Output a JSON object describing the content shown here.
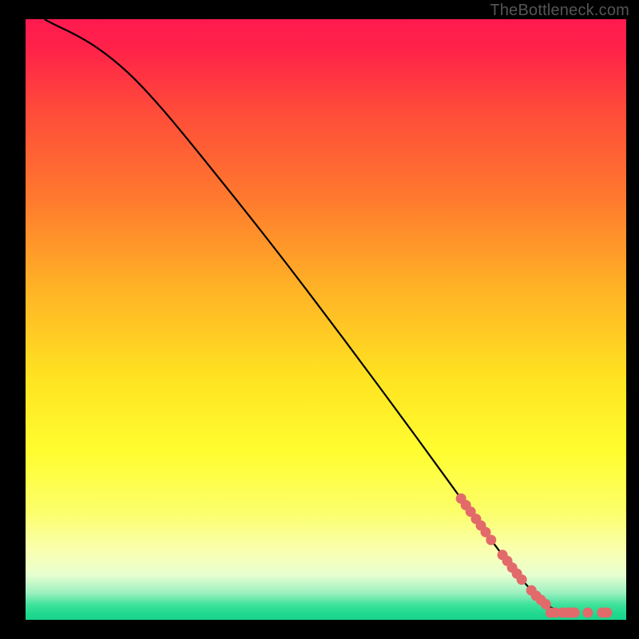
{
  "watermark": "TheBottleneck.com",
  "chart_data": {
    "type": "line",
    "title": "",
    "xlabel": "",
    "ylabel": "",
    "xlim": [
      0,
      100
    ],
    "ylim": [
      0,
      100
    ],
    "background_gradient_stops": [
      {
        "offset": 0.0,
        "color": "#ff1a4f"
      },
      {
        "offset": 0.05,
        "color": "#ff2249"
      },
      {
        "offset": 0.15,
        "color": "#ff4a3a"
      },
      {
        "offset": 0.3,
        "color": "#ff7a2e"
      },
      {
        "offset": 0.45,
        "color": "#ffb326"
      },
      {
        "offset": 0.6,
        "color": "#ffe421"
      },
      {
        "offset": 0.72,
        "color": "#fffd30"
      },
      {
        "offset": 0.82,
        "color": "#fcff6a"
      },
      {
        "offset": 0.885,
        "color": "#f9ffb0"
      },
      {
        "offset": 0.925,
        "color": "#e8ffd0"
      },
      {
        "offset": 0.955,
        "color": "#9cf0c0"
      },
      {
        "offset": 0.975,
        "color": "#3ee29a"
      },
      {
        "offset": 0.99,
        "color": "#1fd98f"
      },
      {
        "offset": 1.0,
        "color": "#18d48b"
      }
    ],
    "curve": [
      {
        "x": 3.1,
        "y": 100.0
      },
      {
        "x": 5.0,
        "y": 99.0
      },
      {
        "x": 8.0,
        "y": 97.6
      },
      {
        "x": 12.0,
        "y": 95.3
      },
      {
        "x": 17.0,
        "y": 91.3
      },
      {
        "x": 22.0,
        "y": 86.0
      },
      {
        "x": 27.0,
        "y": 80.0
      },
      {
        "x": 32.0,
        "y": 73.8
      },
      {
        "x": 38.0,
        "y": 66.3
      },
      {
        "x": 44.0,
        "y": 58.6
      },
      {
        "x": 50.0,
        "y": 50.7
      },
      {
        "x": 56.0,
        "y": 42.7
      },
      {
        "x": 62.0,
        "y": 34.6
      },
      {
        "x": 68.0,
        "y": 26.4
      },
      {
        "x": 73.0,
        "y": 19.5
      },
      {
        "x": 78.0,
        "y": 12.6
      },
      {
        "x": 82.0,
        "y": 7.4
      },
      {
        "x": 85.0,
        "y": 4.0
      },
      {
        "x": 87.0,
        "y": 2.3
      },
      {
        "x": 88.5,
        "y": 1.5
      },
      {
        "x": 89.5,
        "y": 1.2
      },
      {
        "x": 90.0,
        "y": 1.2
      }
    ],
    "marker_color": "#e26a6a",
    "markers_on_curve": [
      {
        "x": 72.5,
        "y": 20.2
      },
      {
        "x": 73.3,
        "y": 19.1
      },
      {
        "x": 74.1,
        "y": 18.0
      },
      {
        "x": 75.0,
        "y": 16.8
      },
      {
        "x": 75.8,
        "y": 15.7
      },
      {
        "x": 76.6,
        "y": 14.6
      },
      {
        "x": 77.5,
        "y": 13.3
      },
      {
        "x": 79.4,
        "y": 10.8
      },
      {
        "x": 80.2,
        "y": 9.8
      },
      {
        "x": 81.0,
        "y": 8.7
      },
      {
        "x": 81.8,
        "y": 7.7
      },
      {
        "x": 82.6,
        "y": 6.7
      },
      {
        "x": 84.2,
        "y": 4.9
      },
      {
        "x": 85.0,
        "y": 4.0
      },
      {
        "x": 85.8,
        "y": 3.3
      },
      {
        "x": 86.6,
        "y": 2.6
      }
    ],
    "markers_flat": [
      {
        "x": 87.4,
        "y": 1.2
      },
      {
        "x": 88.2,
        "y": 1.2
      },
      {
        "x": 89.4,
        "y": 1.2
      },
      {
        "x": 90.2,
        "y": 1.2
      },
      {
        "x": 90.8,
        "y": 1.2
      },
      {
        "x": 91.4,
        "y": 1.2
      },
      {
        "x": 93.6,
        "y": 1.2
      },
      {
        "x": 96.0,
        "y": 1.2
      },
      {
        "x": 96.8,
        "y": 1.2
      }
    ]
  }
}
